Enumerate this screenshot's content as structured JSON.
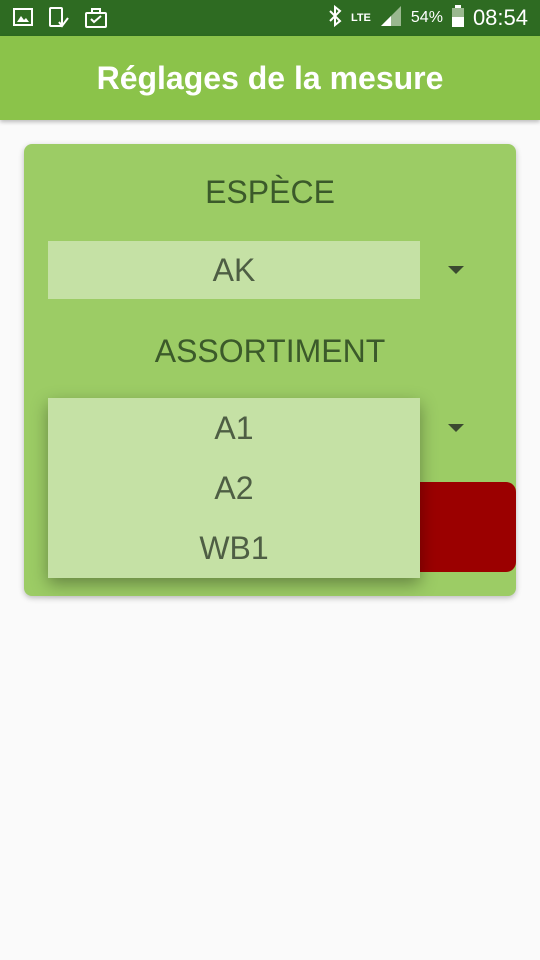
{
  "status_bar": {
    "battery_percent": "54%",
    "time": "08:54",
    "network": "LTE",
    "icons": [
      "image-icon",
      "download-icon",
      "briefcase-icon",
      "bluetooth-icon",
      "signal-icon",
      "battery-icon"
    ]
  },
  "app_bar": {
    "title": "Réglages de la mesure"
  },
  "card": {
    "species_label": "ESPÈCE",
    "species_value": "AK",
    "assortment_label": "ASSORTIMENT",
    "assortment_options": [
      "A1",
      "A2",
      "WB1"
    ]
  },
  "colors": {
    "status_bar": "#2e6b22",
    "app_bar": "#8bc34a",
    "card": "#9ccc65",
    "field": "#c5e1a5",
    "button": "#9b0000"
  }
}
